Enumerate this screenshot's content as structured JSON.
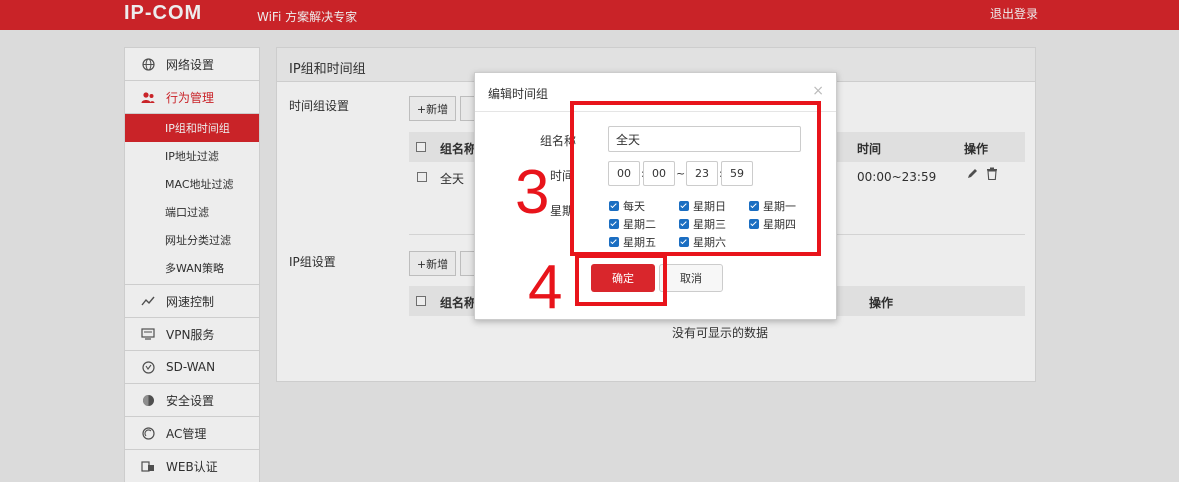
{
  "header": {
    "logo": "IP-COM",
    "tagline": "WiFi 方案解决专家",
    "logout_label": "退出登录",
    "accent_color": "#d9262c"
  },
  "sidebar": {
    "items": [
      {
        "label": "网络设置",
        "icon": "globe-icon"
      },
      {
        "label": "行为管理",
        "icon": "users-icon"
      },
      {
        "label": "网速控制",
        "icon": "speed-icon"
      },
      {
        "label": "VPN服务",
        "icon": "monitor-icon"
      },
      {
        "label": "SD-WAN",
        "icon": "sdwan-icon"
      },
      {
        "label": "安全设置",
        "icon": "shield-icon"
      },
      {
        "label": "AC管理",
        "icon": "ac-icon"
      },
      {
        "label": "WEB认证",
        "icon": "web-auth-icon"
      }
    ],
    "sub_items": [
      "IP组和时间组",
      "IP地址过滤",
      "MAC地址过滤",
      "端口过滤",
      "网址分类过滤",
      "多WAN策略"
    ]
  },
  "panel": {
    "title": "IP组和时间组",
    "time_group": {
      "section_label": "时间组设置",
      "add_label": "+新增",
      "columns": {
        "name": "组名称",
        "time": "时间",
        "action": "操作"
      },
      "rows": [
        {
          "name": "全天",
          "time": "00:00~23:59"
        }
      ]
    },
    "ip_group": {
      "section_label": "IP组设置",
      "add_label": "+新增",
      "columns": {
        "name": "组名称",
        "action": "操作"
      },
      "empty_text": "没有可显示的数据"
    }
  },
  "modal": {
    "title": "编辑时间组",
    "close_glyph": "×",
    "name_label": "组名称",
    "name_value": "全天",
    "time_label": "时间",
    "start_hour": "00",
    "start_min": "00",
    "range_sep": "~",
    "end_hour": "23",
    "end_min": "59",
    "colon": ":",
    "week_label": "星期",
    "days": [
      {
        "label": "每天",
        "checked": true
      },
      {
        "label": "星期日",
        "checked": true
      },
      {
        "label": "星期一",
        "checked": true
      },
      {
        "label": "星期二",
        "checked": true
      },
      {
        "label": "星期三",
        "checked": true
      },
      {
        "label": "星期四",
        "checked": true
      },
      {
        "label": "星期五",
        "checked": true
      },
      {
        "label": "星期六",
        "checked": true
      }
    ],
    "ok_label": "确定",
    "cancel_label": "取消"
  },
  "annotations": {
    "step3": "3",
    "step4": "4",
    "color": "#e8141b"
  }
}
